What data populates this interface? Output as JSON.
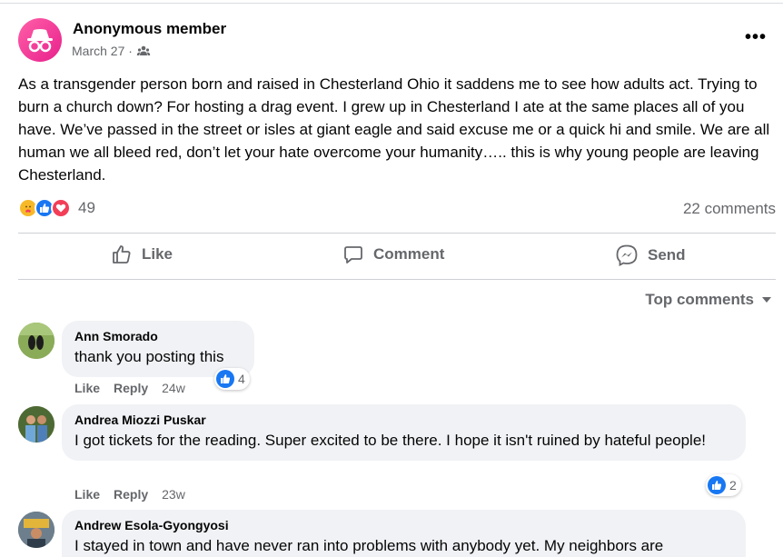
{
  "post": {
    "author": "Anonymous member",
    "date": "March 27 ·",
    "text": "As a transgender person born and raised in Chesterland Ohio it saddens me to see how adults act. Trying to burn a church down? For hosting a drag event. I grew up in Chesterland I ate at the same places all of you have. We’ve passed in the street or isles at giant eagle and said excuse me or a quick hi and smile. We are all human we all bleed red, don’t let your hate overcome your humanity….. this is why young people are leaving Chesterland.",
    "reaction_count": "49",
    "comment_count": "22 comments",
    "more_label": "•••"
  },
  "actions": {
    "like": "Like",
    "comment": "Comment",
    "send": "Send"
  },
  "sort_label": "Top comments",
  "comments": [
    {
      "name": "Ann Smorado",
      "text": "thank you posting this",
      "like": "Like",
      "reply": "Reply",
      "time": "24w",
      "reactions": "4"
    },
    {
      "name": "Andrea Miozzi Puskar",
      "text": "I got tickets for the reading. Super excited to be there. I hope it isn't ruined by hateful people!",
      "like": "Like",
      "reply": "Reply",
      "time": "23w",
      "reactions": "2"
    },
    {
      "name": "Andrew Esola-Gyongyosi",
      "text": "I stayed in town and have never ran into problems with anybody yet. My neighbors are"
    }
  ],
  "colors": {
    "accent": "#1877f2",
    "love": "#f33e58",
    "care": "#f7b928",
    "avatar": "#e8218c",
    "muted": "#65676b"
  }
}
